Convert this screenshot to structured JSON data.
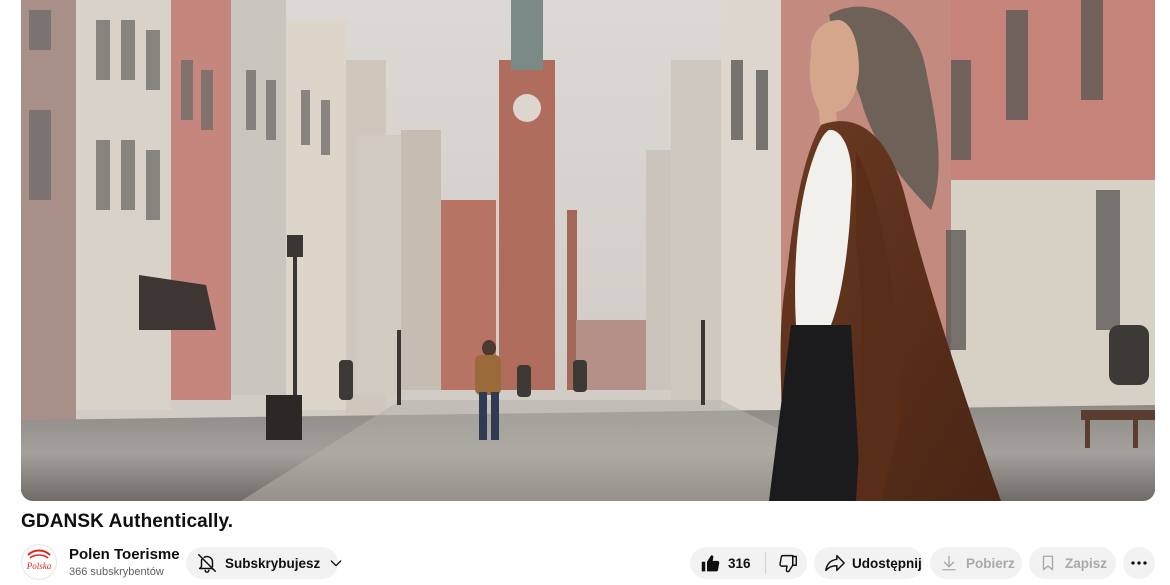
{
  "video": {
    "title": "GDANSK Authentically."
  },
  "channel": {
    "name": "Polen Toerisme",
    "subscribers": "366 subskrybentów",
    "avatar_text": "Polska"
  },
  "actions": {
    "subscribe_label": "Subskrybujesz",
    "like_count": "316",
    "share_label": "Udostępnij",
    "download_label": "Pobierz",
    "save_label": "Zapisz"
  },
  "icons": {
    "notification": "bell-off-icon",
    "subscribe_menu": "chevron-down-icon",
    "like": "thumb-up-icon",
    "dislike": "thumb-down-icon",
    "share": "share-arrow-icon",
    "download": "download-icon",
    "save": "bookmark-icon",
    "more": "more-horizontal-icon"
  },
  "colors": {
    "pill_background": "#f2f2f2",
    "disabled_text": "#a9a9a9",
    "secondary_text": "#606060"
  }
}
